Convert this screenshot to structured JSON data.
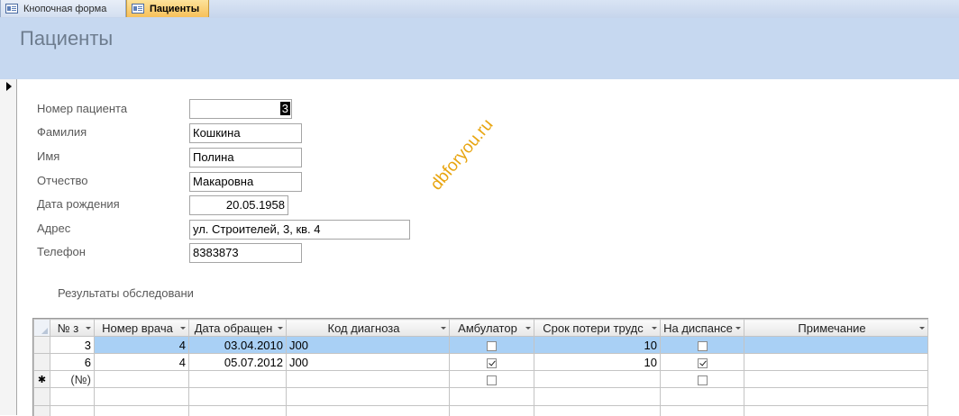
{
  "tabs": [
    {
      "label": "Кнопочная форма",
      "icon": "form-icon",
      "active": false
    },
    {
      "label": "Пациенты",
      "icon": "form-icon",
      "active": true
    }
  ],
  "form": {
    "title": "Пациенты",
    "fields": {
      "patient_number": {
        "label": "Номер пациента",
        "value": "3"
      },
      "last_name": {
        "label": "Фамилия",
        "value": "Кошкина"
      },
      "first_name": {
        "label": "Имя",
        "value": "Полина"
      },
      "patronymic": {
        "label": "Отчество",
        "value": "Макаровна"
      },
      "birth_date": {
        "label": "Дата рождения",
        "value": "20.05.1958"
      },
      "address": {
        "label": "Адрес",
        "value": "ул. Строителей, 3, кв. 4"
      },
      "phone": {
        "label": "Телефон",
        "value": "8383873"
      }
    },
    "subform_label": "Результаты обследовани",
    "watermark": "dbforyou.ru"
  },
  "subform": {
    "columns": [
      "№ з",
      "Номер врача",
      "Дата обращен",
      "Код диагноза",
      "Амбулатор",
      "Срок потери трудс",
      "На диспансе",
      "Примечание"
    ],
    "rows": [
      {
        "no": "3",
        "doctor": "4",
        "date": "03.04.2010",
        "diag": "J00",
        "ambulatory": false,
        "sick_days": "10",
        "dispensary": false,
        "note": ""
      },
      {
        "no": "6",
        "doctor": "4",
        "date": "05.07.2012",
        "diag": "J00",
        "ambulatory": true,
        "sick_days": "10",
        "dispensary": true,
        "note": ""
      }
    ],
    "new_row": {
      "marker": "✱",
      "no": "(№)"
    }
  },
  "colors": {
    "header_bg": "#c6d8f0",
    "selected_row": "#a9d0f5",
    "active_tab": "#f7c05a",
    "watermark": "#e8a510"
  }
}
